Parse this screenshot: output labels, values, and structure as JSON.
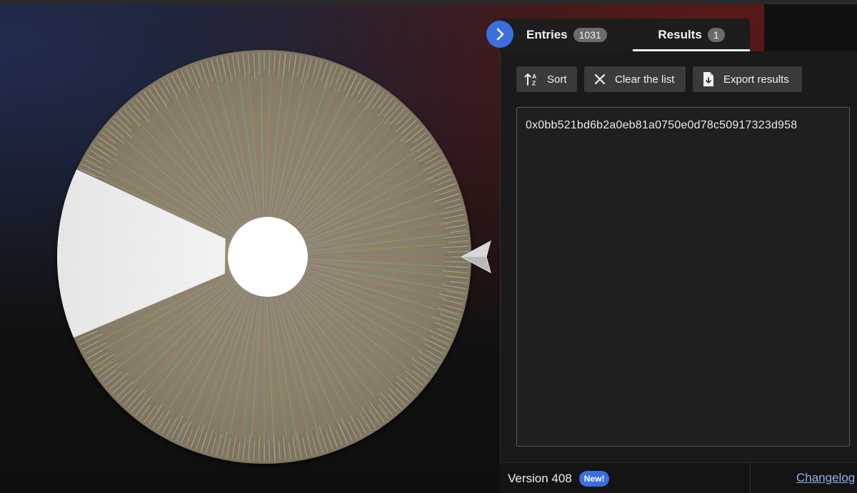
{
  "tabs": {
    "entries": {
      "label": "Entries",
      "count": "1031"
    },
    "results": {
      "label": "Results",
      "count": "1"
    }
  },
  "toolbar": {
    "sort_label": "Sort",
    "clear_label": "Clear the list",
    "export_label": "Export results"
  },
  "results": [
    "0x0bb521bd6b2a0eb81a0750e0d78c50917323d958"
  ],
  "footer": {
    "version": "Version 408",
    "new_badge": "New!",
    "changelog": "Changelog"
  },
  "icons": {
    "collapse": "chevron-right-icon",
    "sort": "sort-az-icon",
    "clear": "close-icon",
    "export": "file-download-icon",
    "pointer": "triangle-pointer-icon"
  },
  "colors": {
    "accent": "#3b6fe0",
    "panel_bg": "#1a1a1a",
    "wheel_base": "#8b8068",
    "selected_slice": "#f2f2f2",
    "link": "#8fb0e8"
  },
  "wheel": {
    "segments": 1031,
    "selected_segments": 1
  }
}
